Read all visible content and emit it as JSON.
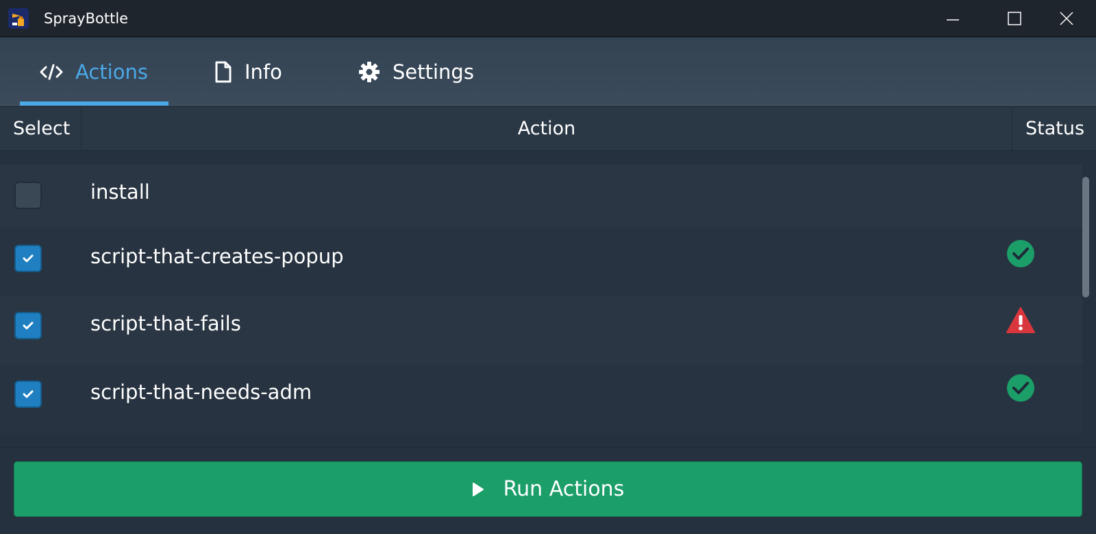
{
  "window": {
    "title": "SprayBottle",
    "controls": [
      "minimize",
      "maximize",
      "close"
    ]
  },
  "tabs": [
    {
      "label": "Actions",
      "icon": "code-icon",
      "active": true
    },
    {
      "label": "Info",
      "icon": "document-icon",
      "active": false
    },
    {
      "label": "Settings",
      "icon": "gear-icon",
      "active": false
    }
  ],
  "table": {
    "headers": {
      "select": "Select",
      "action": "Action",
      "status": "Status"
    },
    "rows": [
      {
        "label": "install",
        "checked": false,
        "status": "none"
      },
      {
        "label": "script-that-creates-popup",
        "checked": true,
        "status": "success"
      },
      {
        "label": "script-that-fails",
        "checked": true,
        "status": "error"
      },
      {
        "label": "script-that-needs-adm",
        "checked": true,
        "status": "success"
      }
    ]
  },
  "run_button": {
    "label": "Run Actions",
    "icon": "play-icon"
  },
  "colors": {
    "accent": "#4aa9e8",
    "success": "#1c9e69",
    "error": "#d9363e",
    "checkbox": "#1f7fc0"
  }
}
